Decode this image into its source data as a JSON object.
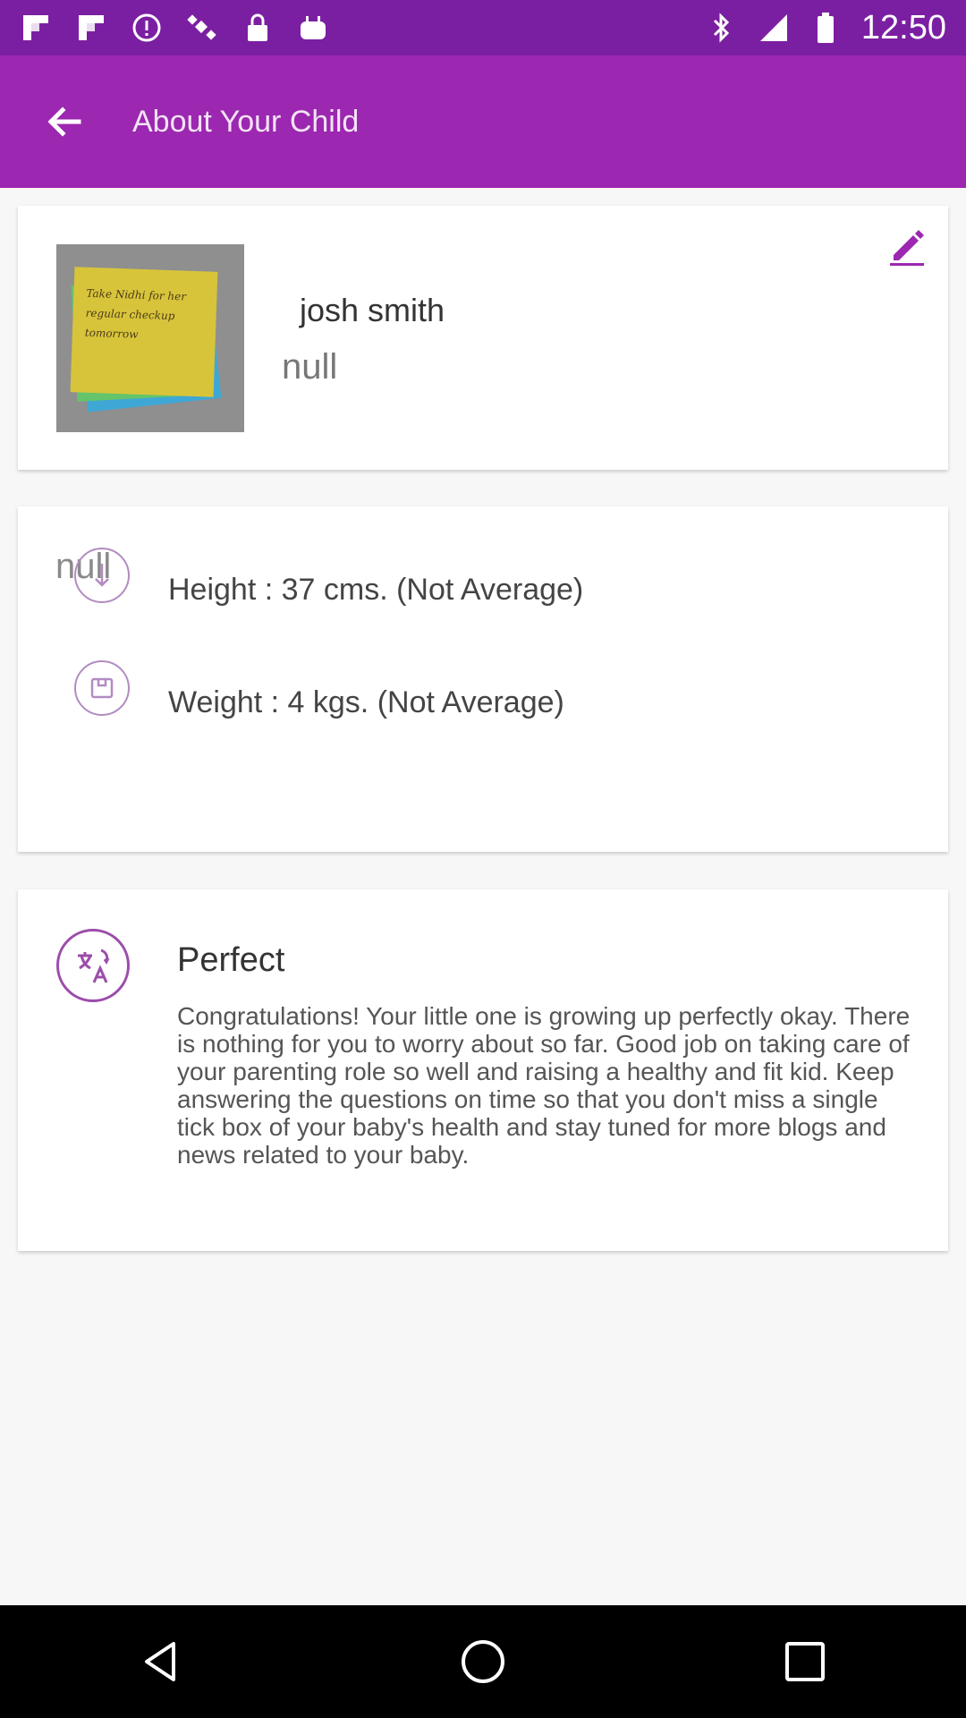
{
  "status_bar": {
    "time": "12:50",
    "icons_left": [
      "flipboard-icon",
      "flipboard-icon",
      "alert-icon",
      "satellite-icon",
      "lock-icon",
      "android-icon"
    ],
    "icons_right": [
      "bluetooth-icon",
      "signal-icon",
      "battery-icon"
    ]
  },
  "app_bar": {
    "title": "About Your Child",
    "background": "#9c27b0"
  },
  "profile": {
    "name": " josh smith",
    "subtitle": "null",
    "note_text": "Take Nidhi for her regular checkup tomorrow"
  },
  "metrics": {
    "null_label": "null",
    "height_text": "Height  : 37 cms. (Not Average)",
    "weight_text": "Weight  : 4 kgs. (Not Average)"
  },
  "status": {
    "title": "Perfect",
    "description": "Congratulations! Your little one is growing up perfectly okay. There is nothing for you to worry about so far. Good job on taking care of your parenting role so well and raising a healthy and fit kid. Keep answering the questions on time so that you don't miss a single tick box of your baby's health and stay tuned for more blogs and news related to your baby."
  },
  "colors": {
    "primary": "#9c27b0",
    "primary_dark": "#7b1fa2",
    "icon_accent": "#9c4dab"
  }
}
